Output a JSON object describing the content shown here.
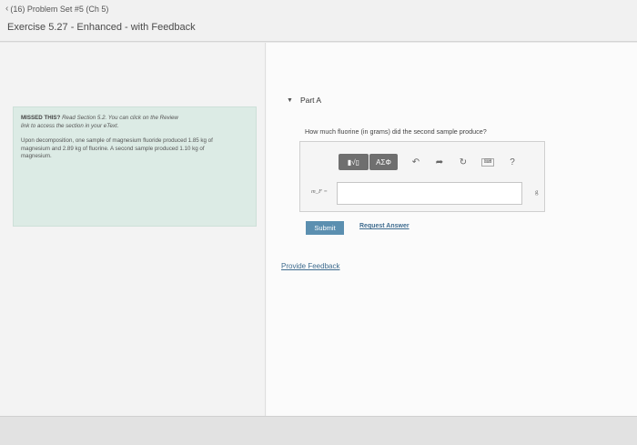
{
  "header": {
    "breadcrumb": "(16) Problem Set #5 (Ch 5)",
    "exercise_title": "Exercise 5.27 - Enhanced - with Feedback"
  },
  "left": {
    "missed_label": "MISSED THIS?",
    "missed_text_line1": "Read Section 5.2. You can click on the Review",
    "missed_text_line2": "link to access the section in your eText.",
    "problem_text": "Upon decomposition, one sample of magnesium fluoride produced 1.85 kg of magnesium and 2.89 kg of fluorine. A second sample produced 1.10 kg of magnesium."
  },
  "part": {
    "label": "Part A",
    "question": "How much fluorine (in grams) did the second sample produce?"
  },
  "toolbar": {
    "template_label": "▮√▯",
    "symbols_label": "ΑΣΦ",
    "undo_icon": "undo-icon",
    "redo_icon": "redo-icon",
    "reset_icon": "reset-icon",
    "keyboard_icon": "keyboard-icon",
    "help_label": "?"
  },
  "answer": {
    "variable_label": "m_F =",
    "value": "",
    "unit": "g"
  },
  "actions": {
    "submit_label": "Submit",
    "request_answer_label": "Request Answer",
    "provide_feedback_label": "Provide Feedback"
  },
  "colors": {
    "missed_bg": "#dcebe5",
    "submit_bg": "#5b8fb0",
    "link": "#3f6c8f"
  }
}
